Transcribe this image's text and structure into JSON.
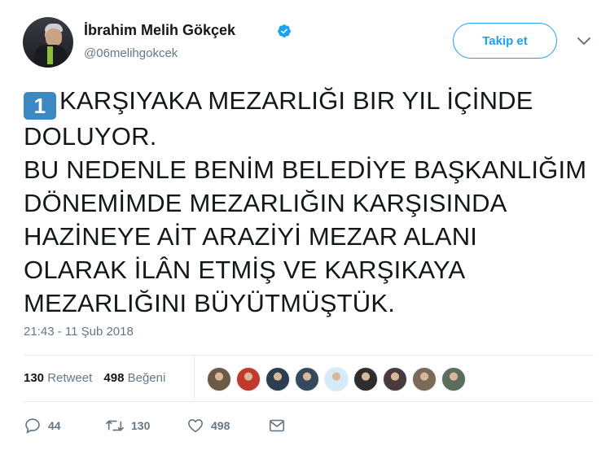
{
  "author": {
    "name": "İbrahim Melih Gökçek",
    "handle": "@06melihgokcek",
    "verified": true
  },
  "follow_button": {
    "label": "Takip et"
  },
  "tweet": {
    "keycap": "1",
    "lines": [
      "KARŞIYAKA MEZARLIĞI BIR YIL İÇİNDE",
      "DOLUYOR.",
      "BU NEDENLE BENİM BELEDİYE BAŞKANLIĞIM",
      "DÖNEMİMDE MEZARLIĞIN KARŞISINDA",
      "HAZİNEYE AİT ARAZİYİ MEZAR ALANI",
      "OLARAK İLÂN ETMİŞ VE KARŞIKAYA",
      "MEZARLIĞINI BÜYÜTMÜŞTÜK."
    ],
    "timestamp": "21:43 - 11 Şub 2018"
  },
  "stats": {
    "retweet_count": "130",
    "retweet_label": "Retweet",
    "like_count": "498",
    "like_label": "Beğeni"
  },
  "likers_avatars": [
    {
      "name": "liker-avatar-1",
      "color": "#6b5a45"
    },
    {
      "name": "liker-avatar-2",
      "color": "#c0392b"
    },
    {
      "name": "liker-avatar-3",
      "color": "#2c3e50"
    },
    {
      "name": "liker-avatar-4",
      "color": "#34495e"
    },
    {
      "name": "liker-avatar-5",
      "color": "#d6eaf8"
    },
    {
      "name": "liker-avatar-6",
      "color": "#2d2d2d"
    },
    {
      "name": "liker-avatar-7",
      "color": "#4a3b3b"
    },
    {
      "name": "liker-avatar-8",
      "color": "#7a6a5a"
    },
    {
      "name": "liker-avatar-9",
      "color": "#5d6d5d"
    }
  ],
  "actions": {
    "reply_count": "44",
    "retweet_count": "130",
    "like_count": "498"
  },
  "colors": {
    "accent": "#1da1f2",
    "secondary_text": "#657786",
    "keycap": "#3b88c3"
  }
}
